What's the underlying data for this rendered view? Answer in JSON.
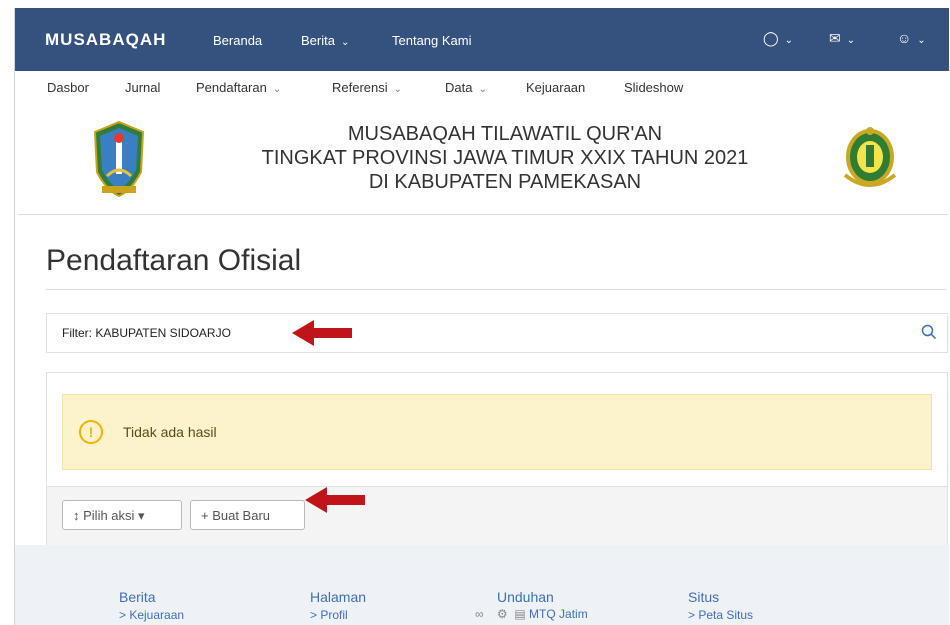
{
  "navbar": {
    "brand": "MUSABAQAH",
    "links": [
      "Beranda",
      "Berita",
      "Tentang Kami"
    ],
    "icons": [
      "chat-icon",
      "mail-icon",
      "user-icon"
    ]
  },
  "subnav": [
    "Dasbor",
    "Jurnal",
    "Pendaftaran",
    "Referensi",
    "Data",
    "Kejuaraan",
    "Slideshow"
  ],
  "banner": {
    "line1": "MUSABAQAH TILAWATIL QUR'AN",
    "line2": "TINGKAT PROVINSI JAWA TIMUR XXIX TAHUN 2021",
    "line3": "DI KABUPATEN PAMEKASAN"
  },
  "page_title": "Pendaftaran Ofisial",
  "filter": {
    "text": "Filter: KABUPATEN SIDOARJO"
  },
  "alert": {
    "text": "Tidak ada hasil"
  },
  "actions": {
    "choose_action": "Pilih aksi",
    "create_new": "+ Buat Baru"
  },
  "footer": {
    "columns": [
      {
        "title": "Berita",
        "link": "> Kejuaraan"
      },
      {
        "title": "Halaman",
        "link": "> Profil"
      },
      {
        "title": "Unduhan",
        "link": "MTQ Jatim"
      },
      {
        "title": "Situs",
        "link": "> Peta Situs"
      }
    ]
  },
  "colors": {
    "navbar": "#34527d",
    "alert_bg": "#fcf2cc",
    "alert_icon": "#f0b400",
    "arrow": "#c0141b",
    "link": "#3d6fb5"
  }
}
